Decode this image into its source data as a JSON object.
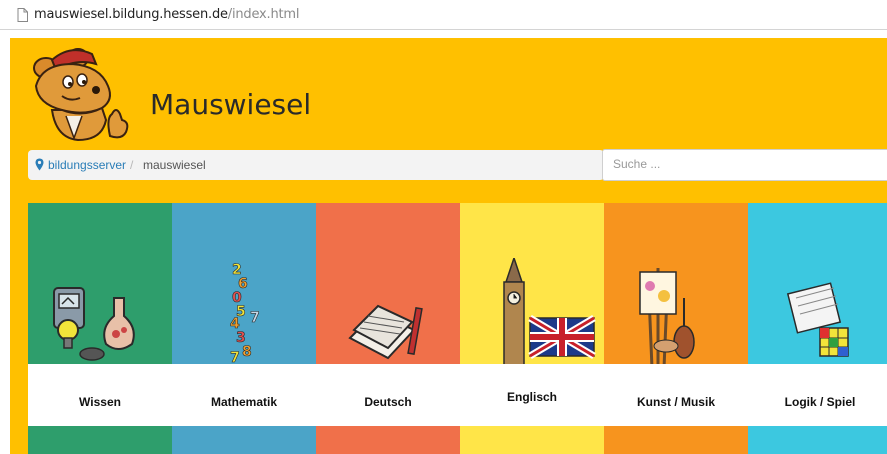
{
  "browser": {
    "url_domain": "mauswiesel.bildung.hessen.de",
    "url_path": "/index.html"
  },
  "header": {
    "site_title": "Mauswiesel",
    "logo_icon": "weasel-mascot-icon",
    "background_color": "#FFC000"
  },
  "breadcrumb": {
    "home": "bildungsserver",
    "separator": "/",
    "current": "mauswiesel"
  },
  "search": {
    "placeholder": "Suche ..."
  },
  "categories": [
    {
      "label": "Wissen",
      "color": "#2E9E6C",
      "icon": "science-equipment-icon"
    },
    {
      "label": "Mathematik",
      "color": "#4BA4C8",
      "icon": "numbers-icon"
    },
    {
      "label": "Deutsch",
      "color": "#F0704A",
      "icon": "books-pen-icon"
    },
    {
      "label": "Englisch",
      "color": "#FFE548",
      "icon": "big-ben-union-jack-icon"
    },
    {
      "label": "Kunst / Musik",
      "color": "#F7941E",
      "icon": "easel-violin-icon"
    },
    {
      "label": "Logik / Spiel",
      "color": "#3CC8E0",
      "icon": "calendar-cube-icon"
    }
  ]
}
